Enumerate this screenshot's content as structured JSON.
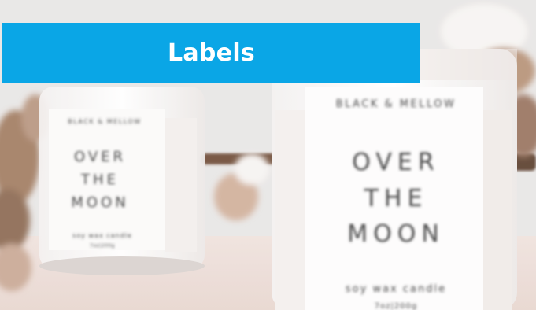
{
  "banner": {
    "title": "Labels",
    "color": "#0aa6e6"
  },
  "photo": {
    "front_candle": {
      "brand": "BLACK & MELLOW",
      "lines": [
        "OVER",
        "THE",
        "MOON"
      ],
      "subtitle": "soy wax candle",
      "weight": "7oz|200g"
    },
    "back_candle": {
      "brand": "BLACK & MELLOW",
      "lines": [
        "OVER",
        "THE",
        "MOON"
      ],
      "subtitle": "soy wax candle",
      "weight": "7oz|200g"
    }
  }
}
